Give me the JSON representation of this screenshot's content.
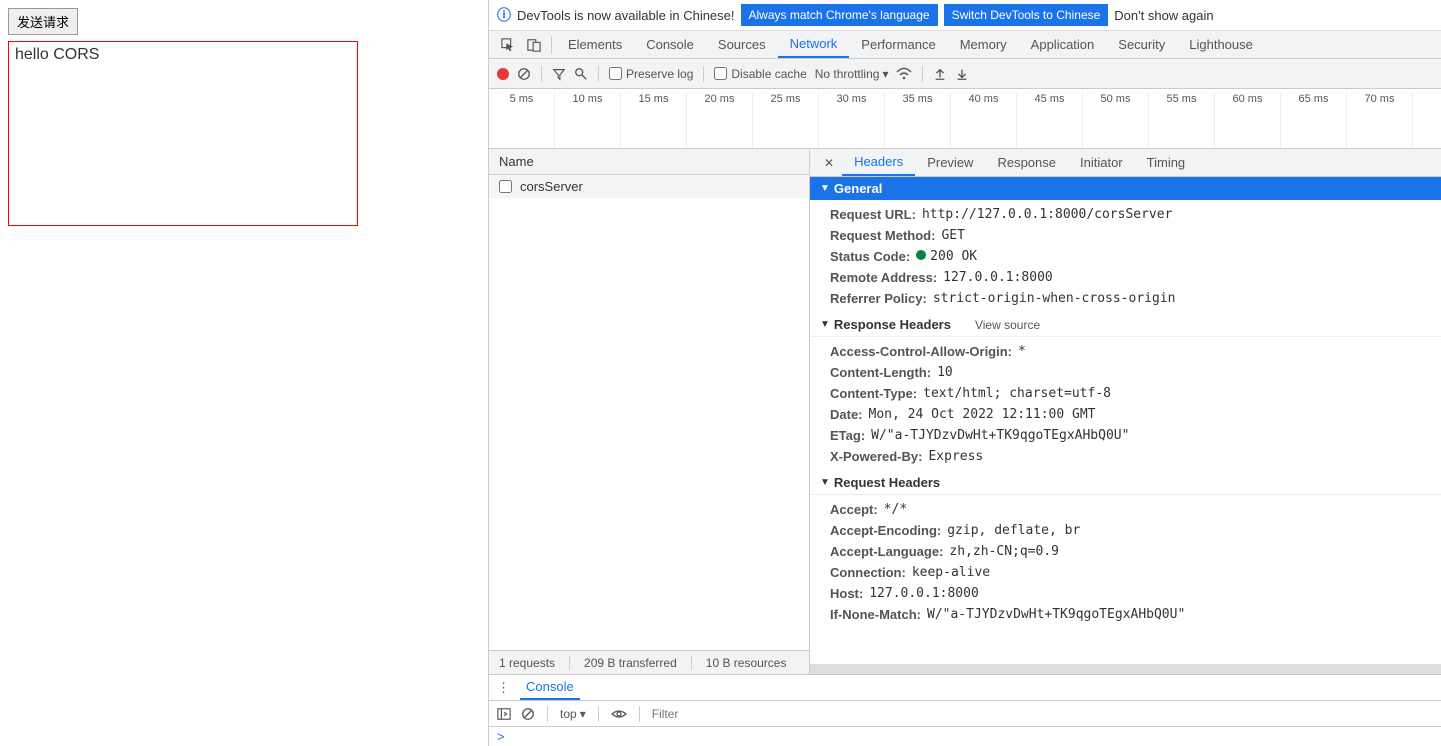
{
  "left": {
    "button_label": "发送请求",
    "output_text": "hello CORS"
  },
  "info_bar": {
    "text": "DevTools is now available in Chinese!",
    "btn1": "Always match Chrome's language",
    "btn2": "Switch DevTools to Chinese",
    "link": "Don't show again"
  },
  "main_tabs": [
    "Elements",
    "Console",
    "Sources",
    "Network",
    "Performance",
    "Memory",
    "Application",
    "Security",
    "Lighthouse"
  ],
  "main_tab_active": "Network",
  "toolbar": {
    "preserve_log": "Preserve log",
    "disable_cache": "Disable cache",
    "throttling": "No throttling"
  },
  "timeline": [
    "5 ms",
    "10 ms",
    "15 ms",
    "20 ms",
    "25 ms",
    "30 ms",
    "35 ms",
    "40 ms",
    "45 ms",
    "50 ms",
    "55 ms",
    "60 ms",
    "65 ms",
    "70 ms"
  ],
  "name_col": {
    "header": "Name",
    "rows": [
      "corsServer"
    ]
  },
  "detail_tabs": [
    "Headers",
    "Preview",
    "Response",
    "Initiator",
    "Timing"
  ],
  "detail_tab_active": "Headers",
  "sections": {
    "general": {
      "title": "General",
      "items": [
        {
          "k": "Request URL:",
          "v": "http://127.0.0.1:8000/corsServer"
        },
        {
          "k": "Request Method:",
          "v": "GET"
        },
        {
          "k": "Status Code:",
          "v": "200 OK",
          "status": true
        },
        {
          "k": "Remote Address:",
          "v": "127.0.0.1:8000"
        },
        {
          "k": "Referrer Policy:",
          "v": "strict-origin-when-cross-origin"
        }
      ]
    },
    "response": {
      "title": "Response Headers",
      "view_source": "View source",
      "items": [
        {
          "k": "Access-Control-Allow-Origin:",
          "v": "*"
        },
        {
          "k": "Content-Length:",
          "v": "10"
        },
        {
          "k": "Content-Type:",
          "v": "text/html; charset=utf-8"
        },
        {
          "k": "Date:",
          "v": "Mon, 24 Oct 2022 12:11:00 GMT"
        },
        {
          "k": "ETag:",
          "v": "W/\"a-TJYDzvDwHt+TK9qgoTEgxAHbQ0U\""
        },
        {
          "k": "X-Powered-By:",
          "v": "Express"
        }
      ]
    },
    "request": {
      "title": "Request Headers",
      "items": [
        {
          "k": "Accept:",
          "v": "*/*"
        },
        {
          "k": "Accept-Encoding:",
          "v": "gzip, deflate, br"
        },
        {
          "k": "Accept-Language:",
          "v": "zh,zh-CN;q=0.9"
        },
        {
          "k": "Connection:",
          "v": "keep-alive"
        },
        {
          "k": "Host:",
          "v": "127.0.0.1:8000"
        },
        {
          "k": "If-None-Match:",
          "v": "W/\"a-TJYDzvDwHt+TK9qgoTEgxAHbQ0U\""
        }
      ]
    }
  },
  "footer": {
    "requests": "1 requests",
    "transferred": "209 B transferred",
    "resources": "10 B resources"
  },
  "console": {
    "tab": "Console",
    "context": "top",
    "filter_placeholder": "Filter",
    "prompt": ">"
  }
}
